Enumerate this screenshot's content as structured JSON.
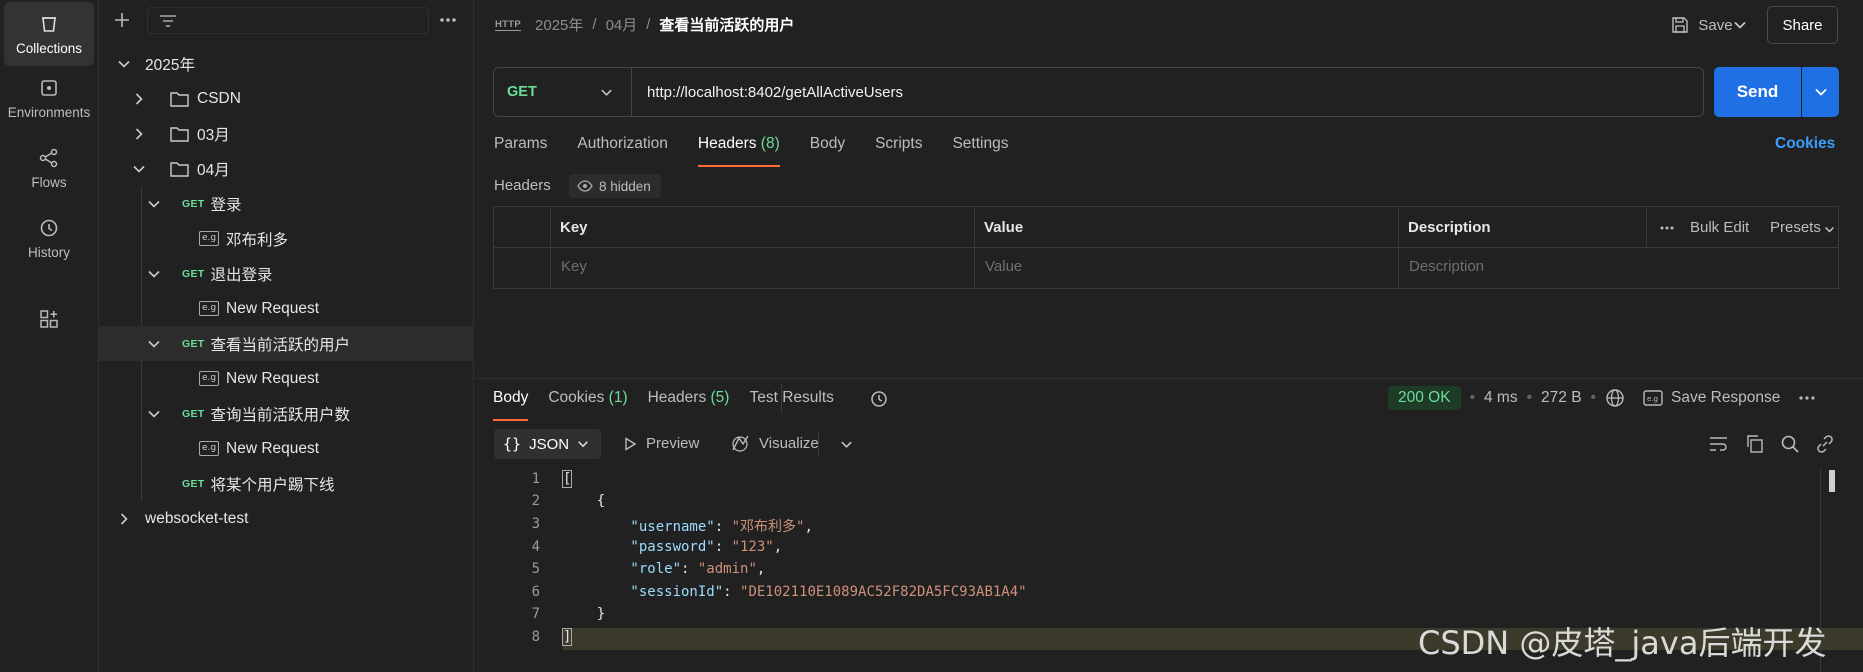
{
  "rail": [
    {
      "label": "Collections",
      "icon": "collections-icon"
    },
    {
      "label": "Environments",
      "icon": "environments-icon"
    },
    {
      "label": "Flows",
      "icon": "flows-icon"
    },
    {
      "label": "History",
      "icon": "history-icon"
    }
  ],
  "tree": {
    "root": "2025年",
    "folders": [
      "CSDN",
      "03月",
      "04月"
    ],
    "items": [
      {
        "method": "GET",
        "name": "登录"
      },
      {
        "example": "e.g",
        "name": "邓布利多"
      },
      {
        "method": "GET",
        "name": "退出登录"
      },
      {
        "example": "e.g",
        "name": "New Request"
      },
      {
        "method": "GET",
        "name": "查看当前活跃的用户"
      },
      {
        "example": "e.g",
        "name": "New Request"
      },
      {
        "method": "GET",
        "name": "查询当前活跃用户数"
      },
      {
        "example": "e.g",
        "name": "New Request"
      },
      {
        "method": "GET",
        "name": "将某个用户踢下线"
      }
    ],
    "other": "websocket-test"
  },
  "breadcrumb": {
    "badge": "HTTP",
    "parts": [
      "2025年",
      "04月"
    ],
    "current": "查看当前活跃的用户"
  },
  "header": {
    "save": "Save",
    "share": "Share"
  },
  "request": {
    "method": "GET",
    "url": "http://localhost:8402/getAllActiveUsers",
    "send": "Send"
  },
  "req_tabs": {
    "params": "Params",
    "auth": "Authorization",
    "headers": "Headers",
    "headers_count": "(8)",
    "body": "Body",
    "scripts": "Scripts",
    "settings": "Settings",
    "cookies": "Cookies"
  },
  "headers_section": {
    "title": "Headers",
    "hidden": "8 hidden"
  },
  "table": {
    "key": "Key",
    "value": "Value",
    "description": "Description",
    "bulk": "Bulk Edit",
    "presets": "Presets",
    "ph_key": "Key",
    "ph_value": "Value",
    "ph_desc": "Description"
  },
  "resp_tabs": {
    "body": "Body",
    "cookies": "Cookies",
    "cookies_count": "(1)",
    "headers": "Headers",
    "headers_count": "(5)",
    "tests": "Test Results"
  },
  "status": {
    "code": "200 OK",
    "time": "4 ms",
    "size": "272 B",
    "save": "Save Response"
  },
  "viewer": {
    "format": "JSON",
    "preview": "Preview",
    "visualize": "Visualize"
  },
  "code_lines": [
    "[",
    "    {",
    "        \"username\": \"邓布利多\",",
    "        \"password\": \"123\",",
    "        \"role\": \"admin\",",
    "        \"sessionId\": \"DE102110E1089AC52F82DA5FC93AB1A4\"",
    "    }",
    "]"
  ],
  "watermark": "CSDN @皮塔_java后端开发",
  "colors": {
    "accent": "#ff6c37",
    "send": "#1f6fe5",
    "get": "#6bdd9a",
    "link": "#3b9cff"
  }
}
